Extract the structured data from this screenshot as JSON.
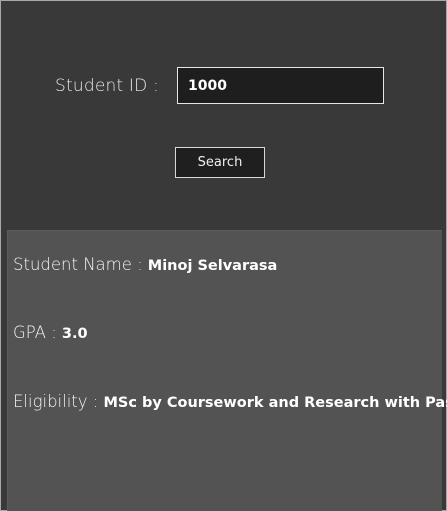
{
  "search": {
    "label": "Student ID :",
    "value": "1000",
    "button_label": "Search"
  },
  "result": {
    "name_label": "Student Name :",
    "name_value": "Minoj Selvarasa",
    "gpa_label": "GPA :",
    "gpa_value": "3.0",
    "eligibility_label": "Eligibility :",
    "eligibility_value": "MSc by Coursework and Research with Pass"
  },
  "colors": {
    "background": "#393939",
    "panel": "#535353",
    "input_bg": "#1e1e1e",
    "text": "#f2f2f2"
  }
}
